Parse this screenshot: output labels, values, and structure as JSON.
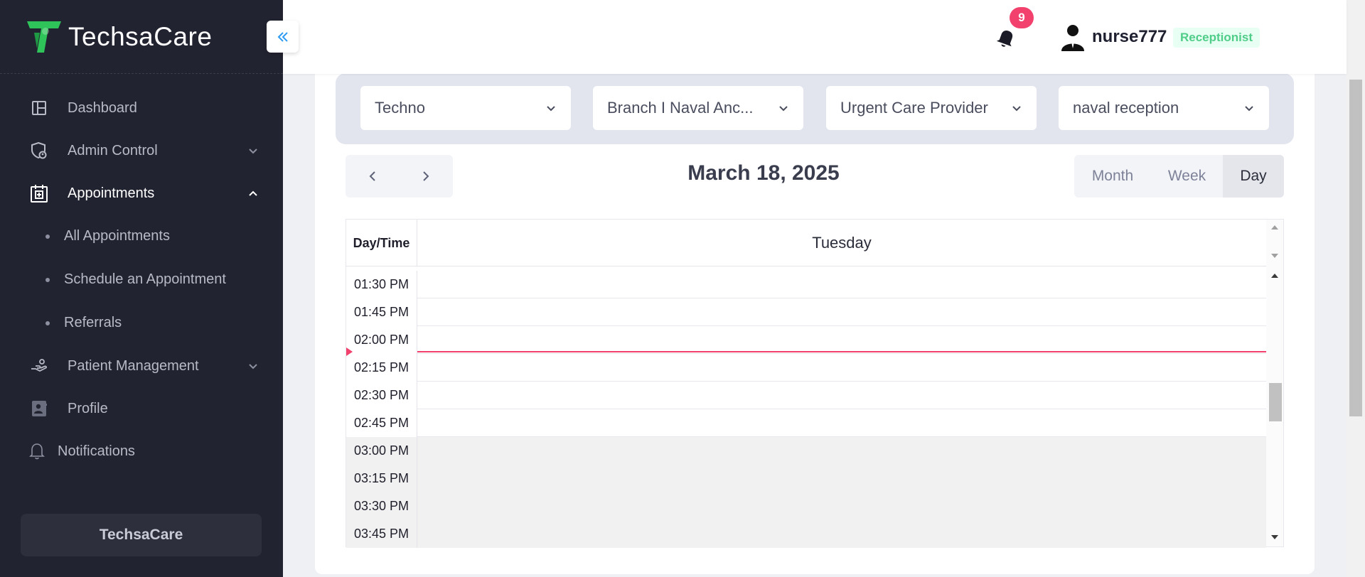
{
  "app": {
    "brand_name": "TechsaCare",
    "footer_label": "TechsaCare"
  },
  "sidebar": {
    "items": [
      {
        "label": "Dashboard",
        "icon": "dashboard-icon"
      },
      {
        "label": "Admin Control",
        "icon": "shield-user-icon",
        "expandable": true,
        "expanded": false
      },
      {
        "label": "Appointments",
        "icon": "calendar-plus-icon",
        "expandable": true,
        "expanded": true,
        "active": true
      },
      {
        "label": "Patient Management",
        "icon": "hand-care-icon",
        "expandable": true,
        "expanded": false
      },
      {
        "label": "Profile",
        "icon": "contact-card-icon"
      },
      {
        "label": "Notifications",
        "icon": "bell-outline-icon"
      }
    ],
    "appointments_sub": [
      {
        "label": "All Appointments"
      },
      {
        "label": "Schedule an Appointment"
      },
      {
        "label": "Referrals"
      }
    ]
  },
  "header": {
    "notification_count": "9",
    "username": "nurse777",
    "role": "Receptionist"
  },
  "filters": [
    {
      "value": "Techno"
    },
    {
      "value": "Branch I Naval Anc..."
    },
    {
      "value": "Urgent Care Provider"
    },
    {
      "value": "naval reception"
    }
  ],
  "calendar": {
    "date_title": "March 18, 2025",
    "views": [
      "Month",
      "Week",
      "Day"
    ],
    "active_view": "Day",
    "time_column_header": "Day/Time",
    "day_header": "Tuesday",
    "slots": [
      {
        "time": "01:30 PM",
        "off_hours": false
      },
      {
        "time": "01:45 PM",
        "off_hours": false
      },
      {
        "time": "02:00 PM",
        "off_hours": false
      },
      {
        "time": "02:15 PM",
        "off_hours": false
      },
      {
        "time": "02:30 PM",
        "off_hours": false
      },
      {
        "time": "02:45 PM",
        "off_hours": false
      },
      {
        "time": "03:00 PM",
        "off_hours": true
      },
      {
        "time": "03:15 PM",
        "off_hours": true
      },
      {
        "time": "03:30 PM",
        "off_hours": true
      },
      {
        "time": "03:45 PM",
        "off_hours": true
      }
    ]
  },
  "colors": {
    "sidebar_bg": "#222330",
    "accent_green": "#2fc45a",
    "current_time_line": "#f1416c",
    "badge_bg": "#f1416c",
    "role_text": "#50cd89"
  }
}
